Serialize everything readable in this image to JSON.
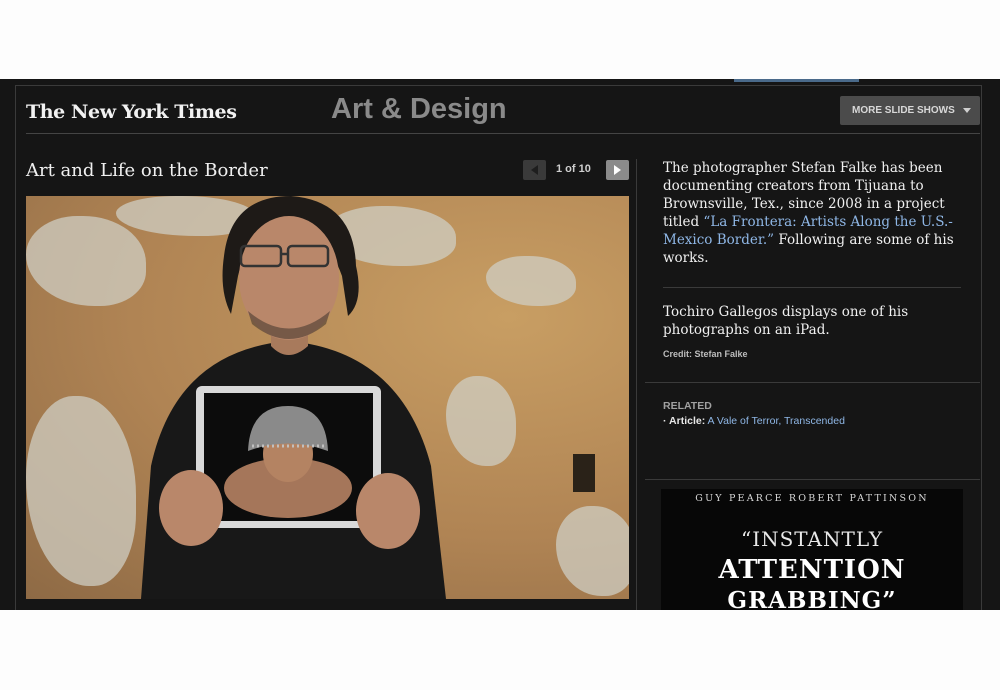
{
  "header": {
    "logo_text": "The New York Times",
    "section_title": "Art & Design",
    "more_slideshows_label": "MORE SLIDE SHOWS"
  },
  "slideshow": {
    "title": "Art and Life on the Border",
    "counter": "1 of 10",
    "photo_alt": "Tochiro Gallegos holding an iPad showing a photograph"
  },
  "sidebar": {
    "intro_part1": "The photographer Stefan Falke has been documenting creators from Tijuana to Brownsville, Tex., since 2008 in a project titled ",
    "intro_link": "“La Frontera: Artists Along the U.S.-Mexico Border.”",
    "intro_part2": " Following are some of his works.",
    "caption": "Tochiro Gallegos displays one of his photographs on an iPad.",
    "credit": "Credit: Stefan Falke",
    "related_heading": "RELATED",
    "related_prefix": "· Article:",
    "related_link": "A Vale of Terror, Transcended"
  },
  "ad": {
    "actors": "GUY PEARCE   ROBERT PATTINSON",
    "quote_line1": "“INSTANTLY",
    "quote_line2": "ATTENTION",
    "quote_line3": "GRABBING”"
  },
  "colors": {
    "background": "#151515",
    "link": "#8fb7e6",
    "accent_tab": "#4a6a8a"
  },
  "icons": [
    "prev-arrow-icon",
    "next-arrow-icon",
    "dropdown-caret-icon"
  ]
}
